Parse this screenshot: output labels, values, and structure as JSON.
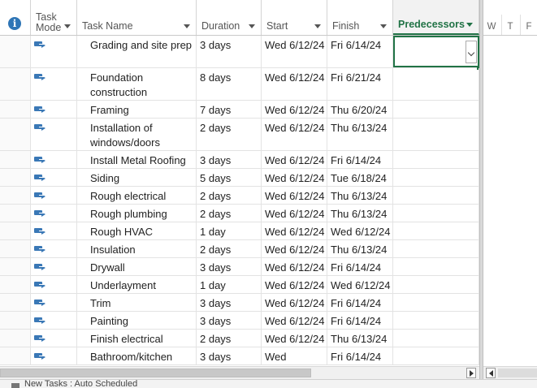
{
  "columns": {
    "task_mode": "Task\nMode",
    "task_name": "Task Name",
    "duration": "Duration",
    "start": "Start",
    "finish": "Finish",
    "predecessors": "Predecessors"
  },
  "timescale_days": [
    "W",
    "T",
    "F"
  ],
  "rows": [
    {
      "name": "Grading and site prep",
      "duration": "3 days",
      "start": "Wed 6/12/24",
      "finish": "Fri 6/14/24",
      "predecessors": ""
    },
    {
      "name": "Foundation construction",
      "duration": "8 days",
      "start": "Wed 6/12/24",
      "finish": "Fri 6/21/24",
      "predecessors": ""
    },
    {
      "name": "Framing",
      "duration": "7 days",
      "start": "Wed 6/12/24",
      "finish": "Thu 6/20/24",
      "predecessors": ""
    },
    {
      "name": "Installation of windows/doors",
      "duration": "2 days",
      "start": "Wed 6/12/24",
      "finish": "Thu 6/13/24",
      "predecessors": ""
    },
    {
      "name": "Install Metal Roofing",
      "duration": "3 days",
      "start": "Wed 6/12/24",
      "finish": "Fri 6/14/24",
      "predecessors": ""
    },
    {
      "name": "Siding",
      "duration": "5 days",
      "start": "Wed 6/12/24",
      "finish": "Tue 6/18/24",
      "predecessors": ""
    },
    {
      "name": "Rough electrical",
      "duration": "2 days",
      "start": "Wed 6/12/24",
      "finish": "Thu 6/13/24",
      "predecessors": ""
    },
    {
      "name": "Rough plumbing",
      "duration": "2 days",
      "start": "Wed 6/12/24",
      "finish": "Thu 6/13/24",
      "predecessors": ""
    },
    {
      "name": "Rough HVAC",
      "duration": "1 day",
      "start": "Wed 6/12/24",
      "finish": "Wed 6/12/24",
      "predecessors": ""
    },
    {
      "name": "Insulation",
      "duration": "2 days",
      "start": "Wed 6/12/24",
      "finish": "Thu 6/13/24",
      "predecessors": ""
    },
    {
      "name": "Drywall",
      "duration": "3 days",
      "start": "Wed 6/12/24",
      "finish": "Fri 6/14/24",
      "predecessors": ""
    },
    {
      "name": "Underlayment",
      "duration": "1 day",
      "start": "Wed 6/12/24",
      "finish": "Wed 6/12/24",
      "predecessors": ""
    },
    {
      "name": "Trim",
      "duration": "3 days",
      "start": "Wed 6/12/24",
      "finish": "Fri 6/14/24",
      "predecessors": ""
    },
    {
      "name": "Painting",
      "duration": "3 days",
      "start": "Wed 6/12/24",
      "finish": "Fri 6/14/24",
      "predecessors": ""
    },
    {
      "name": "Finish electrical",
      "duration": "2 days",
      "start": "Wed 6/12/24",
      "finish": "Thu 6/13/24",
      "predecessors": ""
    },
    {
      "name": "Bathroom/kitchen",
      "duration": "3 days",
      "start": "Wed",
      "finish": "Fri 6/14/24",
      "predecessors": ""
    }
  ],
  "status_bar": "New Tasks : Auto Scheduled",
  "colors": {
    "accent": "#217346",
    "task_icon": "#3a78b6"
  }
}
